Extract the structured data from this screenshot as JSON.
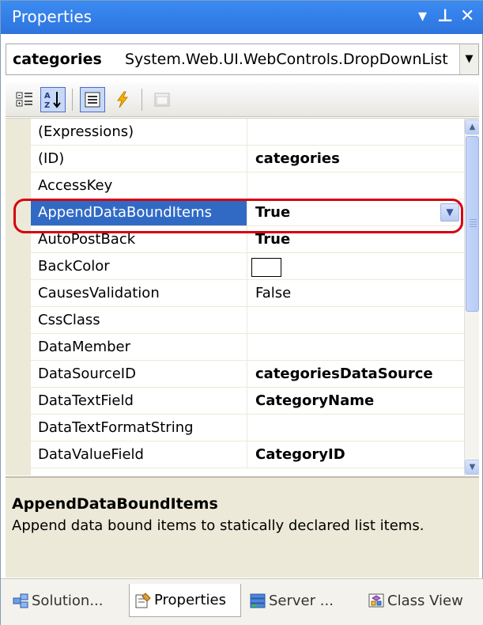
{
  "window": {
    "title": "Properties",
    "buttons": {
      "dropdown": "▾",
      "pin": "⊥",
      "close": "✕"
    }
  },
  "object_selector": {
    "name": "categories",
    "type": "System.Web.UI.WebControls.DropDownList"
  },
  "toolbar": {
    "buttons": [
      "categorized-icon",
      "alphabetical-icon",
      "properties-icon",
      "events-icon",
      "property-pages-icon"
    ],
    "alphabetical_label": "AZ↓"
  },
  "properties": [
    {
      "name": "(Expressions)",
      "value": "",
      "bold": false
    },
    {
      "name": "(ID)",
      "value": "categories",
      "bold": true
    },
    {
      "name": "AccessKey",
      "value": "",
      "bold": false
    },
    {
      "name": "AppendDataBoundItems",
      "value": "True",
      "bold": true,
      "selected": true
    },
    {
      "name": "AutoPostBack",
      "value": "True",
      "bold": true
    },
    {
      "name": "BackColor",
      "value": "",
      "bold": false
    },
    {
      "name": "CausesValidation",
      "value": "False",
      "bold": false
    },
    {
      "name": "CssClass",
      "value": "",
      "bold": false
    },
    {
      "name": "DataMember",
      "value": "",
      "bold": false
    },
    {
      "name": "DataSourceID",
      "value": "categoriesDataSource",
      "bold": true
    },
    {
      "name": "DataTextField",
      "value": "CategoryName",
      "bold": true
    },
    {
      "name": "DataTextFormatString",
      "value": "",
      "bold": false
    },
    {
      "name": "DataValueField",
      "value": "CategoryID",
      "bold": true
    }
  ],
  "description": {
    "title": "AppendDataBoundItems",
    "text": "Append data bound items to statically declared list items."
  },
  "tabs": [
    {
      "label": "Solution...",
      "active": false
    },
    {
      "label": "Properties",
      "active": true
    },
    {
      "label": "Server ...",
      "active": false
    },
    {
      "label": "Class View",
      "active": false
    }
  ],
  "colors": {
    "titlebar": "#2e73de",
    "selection": "#316ac5",
    "highlight_ring": "#d7000f"
  }
}
